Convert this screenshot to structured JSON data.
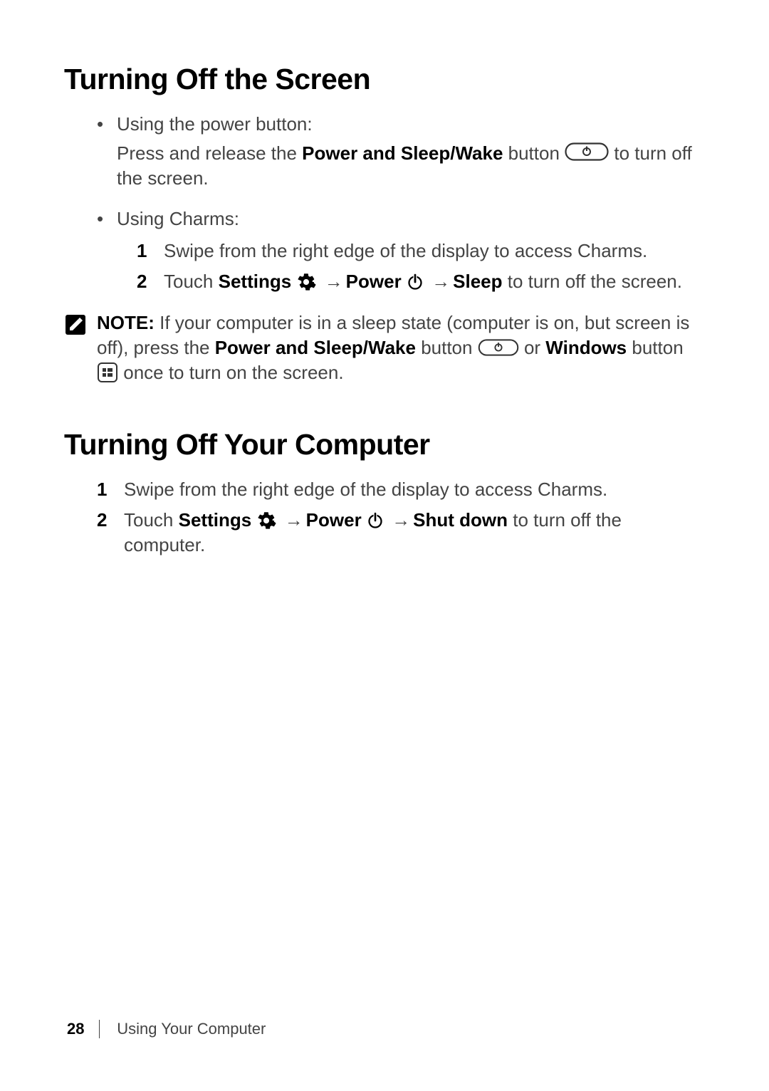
{
  "section1": {
    "title": "Turning Off the Screen",
    "bullet1": {
      "label": "Using the power button:",
      "line_pre": "Press and release the ",
      "bold1": "Power and Sleep/Wake",
      "line_mid": " button ",
      "line_post": " to turn off the screen."
    },
    "bullet2": {
      "label": "Using Charms:",
      "step1": "Swipe from the right edge of the display to access Charms.",
      "step2": {
        "pre": "Touch ",
        "settings": "Settings",
        "arrow1": " → ",
        "power": "Power",
        "arrow2": " → ",
        "sleep": "Sleep",
        "post": " to turn off the screen."
      }
    },
    "note": {
      "label": "NOTE:",
      "line1": " If your computer is in a sleep state (computer is on, but screen is off), press the ",
      "bold1": "Power and Sleep/Wake",
      "mid1": " button ",
      "or": " or ",
      "bold2": "Windows",
      "mid2": " button ",
      "post": " once to turn on the screen."
    }
  },
  "section2": {
    "title": "Turning Off Your Computer",
    "step1": "Swipe from the right edge of the display to access Charms.",
    "step2": {
      "pre": "Touch ",
      "settings": "Settings",
      "arrow1": " → ",
      "power": "Power",
      "arrow2": " → ",
      "shutdown": "Shut down",
      "post": " to turn off the computer."
    }
  },
  "footer": {
    "page": "28",
    "section": "Using Your Computer"
  }
}
